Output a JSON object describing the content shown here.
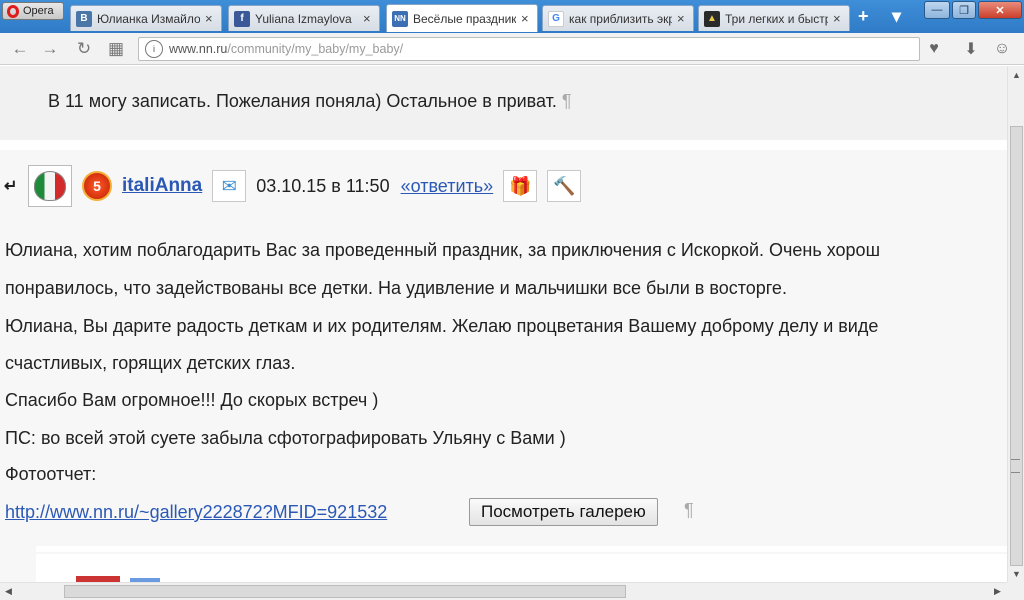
{
  "browser": {
    "menu_label": "Opera",
    "tabs": [
      {
        "label": "Юлианка Измайлова",
        "favicon": "В",
        "favicon_color": "#4a76a8",
        "active": false
      },
      {
        "label": "Yuliana Izmaylova",
        "favicon": "f",
        "favicon_color": "#3b5998",
        "active": false
      },
      {
        "label": "Весёлые праздники",
        "favicon": "NN",
        "favicon_color": "#3c6fb4",
        "active": true
      },
      {
        "label": "как приблизить экр",
        "favicon": "G",
        "favicon_color": "#4285f4",
        "active": false
      },
      {
        "label": "Три легких и быстр",
        "favicon": "▲",
        "favicon_color": "#2a2a2a",
        "active": false
      }
    ],
    "close_glyph": "×",
    "new_tab_glyph": "+",
    "tab_menu_glyph": "▾",
    "window_controls": {
      "minimize": "—",
      "maximize": "❐",
      "close": "✕"
    },
    "nav": {
      "back": "←",
      "forward": "→",
      "reload": "↻",
      "speed_dial": "▦"
    },
    "url": {
      "host": "www.nn.ru",
      "path": "/community/my_baby/my_baby/"
    },
    "toolbar_icons": {
      "bookmark": "♥",
      "download": "⬇",
      "account": "☺"
    }
  },
  "page": {
    "prev_comment_text": "В 11 могу записать. Пожелания поняла) Остальное в приват.",
    "pilcrow": "¶",
    "comment": {
      "reply_arrow": "↵",
      "rank_badge": "5",
      "username": "italiAnna",
      "message_icon": "✉",
      "date": "03.10.15 в 11:50",
      "reply_label": "«ответить»",
      "gift_icon": "🎁",
      "hammer_icon": "🔨",
      "lines": [
        "Юлиана, хотим поблагодарить Вас за проведенный праздник, за приключения с Искоркой. Очень хорош",
        "понравилось, что задействованы все детки. На удивление и мальчишки все были в восторге.",
        "Юлиана, Вы дарите радость деткам и их родителям. Желаю процветания Вашему доброму делу и виде",
        "счастливых, горящих детских глаз.",
        "Спасибо Вам огромное!!! До скорых встреч )",
        "ПС: во всей этой суете забыла сфотографировать Ульяну с Вами )",
        "Фотоотчет:"
      ],
      "gallery_url": "http://www.nn.ru/~gallery222872?MFID=921532",
      "gallery_button": "Посмотреть галерею"
    }
  },
  "scrollbars": {
    "up": "▲",
    "down": "▼",
    "left": "◀",
    "right": "▶"
  }
}
